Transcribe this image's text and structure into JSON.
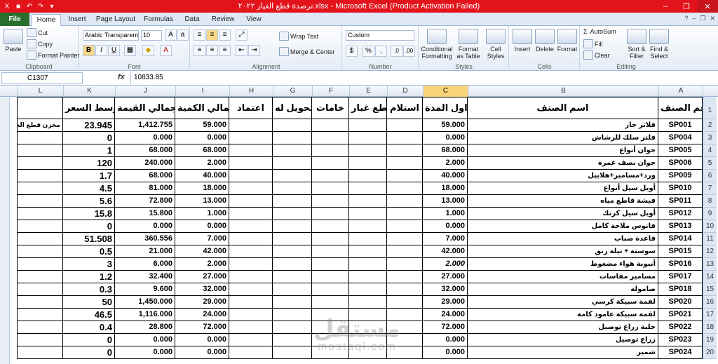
{
  "window": {
    "title": "ترصدة قطع الغيار ٢٠٢٢.xlsx - Microsoft Excel (Product Activation Failed)"
  },
  "ribbon_tabs": [
    "File",
    "Home",
    "Insert",
    "Page Layout",
    "Formulas",
    "Data",
    "Review",
    "View"
  ],
  "ribbon": {
    "clipboard": {
      "label": "Clipboard",
      "paste": "Paste",
      "cut": "Cut",
      "copy": "Copy",
      "format_painter": "Format Painter"
    },
    "font": {
      "label": "Font",
      "name": "Arabic Transparent",
      "size": "10"
    },
    "alignment": {
      "label": "Alignment",
      "wrap": "Wrap Text",
      "merge": "Merge & Center"
    },
    "number": {
      "label": "Number",
      "format": "Custom"
    },
    "styles": {
      "label": "Styles",
      "conditional": "Conditional Formatting",
      "format_table": "Format as Table",
      "cell_styles": "Cell Styles"
    },
    "cells": {
      "label": "Cells",
      "insert": "Insert",
      "delete": "Delete",
      "format": "Format"
    },
    "editing": {
      "label": "Editing",
      "autosum": "AutoSum",
      "fill": "Fill",
      "clear": "Clear",
      "sort": "Sort & Filter",
      "find": "Find & Select"
    }
  },
  "formula_bar": {
    "name_box": "C1307",
    "fx": "fx",
    "value": "10833.85"
  },
  "columns": [
    "L",
    "K",
    "J",
    "I",
    "H",
    "G",
    "F",
    "E",
    "D",
    "C",
    "B",
    "A"
  ],
  "headers": {
    "L": "",
    "K": "متوسط السعر",
    "J": "اجمالي القيمة",
    "I": "اجمالي الكمية",
    "H": "اعتماد",
    "G": "تحويل له",
    "F": "خامات",
    "E": "قطع غيار",
    "D": "استلام",
    "C": "اول المدة",
    "B": "اسم الصنف",
    "A": "رقم الصنف"
  },
  "rows": [
    {
      "n": "2",
      "L": "مخزن قطع الغيار",
      "K": "23.945",
      "J": "1,412.755",
      "I": "59.000",
      "C": "59.000",
      "B": "فلاتر جاز",
      "A": "SP001"
    },
    {
      "n": "3",
      "L": "",
      "K": "0",
      "J": "0.000",
      "I": "0.000",
      "C": "0.000",
      "B": "فلتر سلك للرشاش",
      "A": "SP004"
    },
    {
      "n": "4",
      "L": "",
      "K": "1",
      "J": "68.000",
      "I": "68.000",
      "C": "68.000",
      "B": "جوان أنواع",
      "A": "SP005"
    },
    {
      "n": "5",
      "L": "",
      "K": "120",
      "J": "240.000",
      "I": "2.000",
      "C": "2.000",
      "B": "جوان نصف عمرة",
      "A": "SP006"
    },
    {
      "n": "6",
      "L": "",
      "K": "1.7",
      "J": "68.000",
      "I": "40.000",
      "C": "40.000",
      "B": "ورد+مسامير+هلابيل",
      "A": "SP009"
    },
    {
      "n": "7",
      "L": "",
      "K": "4.5",
      "J": "81.000",
      "I": "18.000",
      "C": "18.000",
      "B": "أويل سيل أنواع",
      "A": "SP010"
    },
    {
      "n": "8",
      "L": "",
      "K": "5.6",
      "J": "72.800",
      "I": "13.000",
      "C": "13.000",
      "B": "فيشة قاطع مياه",
      "A": "SP011"
    },
    {
      "n": "9",
      "L": "",
      "K": "15.8",
      "J": "15.800",
      "I": "1.000",
      "C": "1.000",
      "B": "أويل سيل كرنك",
      "A": "SP012"
    },
    {
      "n": "10",
      "L": "",
      "K": "0",
      "J": "0.000",
      "I": "0.000",
      "C": "0.000",
      "B": "فانوس ملاحة كامل",
      "A": "SP013"
    },
    {
      "n": "11",
      "L": "",
      "K": "51.508",
      "J": "360.556",
      "I": "7.000",
      "C": "7.000",
      "B": "قاعدة صباب",
      "A": "SP014"
    },
    {
      "n": "12",
      "L": "",
      "K": "0.5",
      "J": "21.000",
      "I": "42.000",
      "C": "42.000",
      "B": "سوستة + تيلة زنق",
      "A": "SP015"
    },
    {
      "n": "13",
      "L": "",
      "K": "3",
      "J": "6.000",
      "I": "2.000",
      "C": "2.000",
      "B": "أنبوبة هواء مضغوط",
      "A": "SP016"
    },
    {
      "n": "14",
      "L": "",
      "K": "1.2",
      "J": "32.400",
      "I": "27.000",
      "C": "27.000",
      "B": "مسامير مقاسات",
      "A": "SP017"
    },
    {
      "n": "15",
      "L": "",
      "K": "0.3",
      "J": "9.600",
      "I": "32.000",
      "C": "32.000",
      "B": "صامولة",
      "A": "SP018"
    },
    {
      "n": "16",
      "L": "",
      "K": "50",
      "J": "1,450.000",
      "I": "29.000",
      "C": "29.000",
      "B": "لقمة سبيكة كرسي",
      "A": "SP020"
    },
    {
      "n": "17",
      "L": "",
      "K": "46.5",
      "J": "1,116.000",
      "I": "24.000",
      "C": "24.000",
      "B": "لقمة سبيكة عامود كامة",
      "A": "SP021"
    },
    {
      "n": "18",
      "L": "",
      "K": "0.4",
      "J": "28.800",
      "I": "72.000",
      "C": "72.000",
      "B": "جلبة زراع توصيل",
      "A": "SP022"
    },
    {
      "n": "19",
      "L": "",
      "K": "0",
      "J": "0.000",
      "I": "0.000",
      "C": "0.000",
      "B": "زراع توصيل",
      "A": "SP023"
    },
    {
      "n": "20",
      "L": "",
      "K": "0",
      "J": "0.000",
      "I": "0.000",
      "C": "0.000",
      "B": "شميز",
      "A": "SP024"
    }
  ],
  "row_header_1": "1",
  "watermark": {
    "line1": "مستقل",
    "line2": "mostaql.com"
  }
}
